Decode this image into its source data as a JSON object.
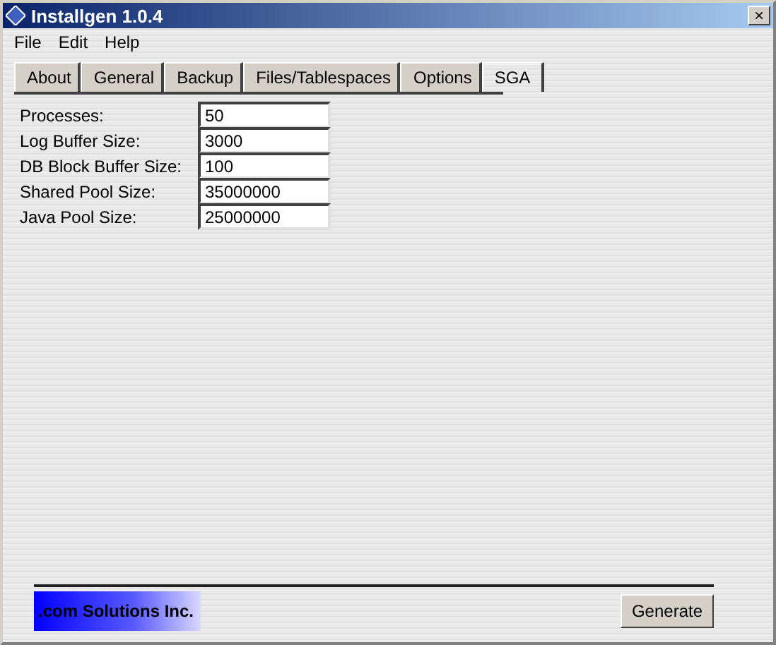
{
  "window": {
    "title": "Installgen 1.0.4",
    "close": "×"
  },
  "menu": [
    "File",
    "Edit",
    "Help"
  ],
  "tabs": [
    {
      "label": "About",
      "selected": false
    },
    {
      "label": "General",
      "selected": false
    },
    {
      "label": "Backup",
      "selected": false
    },
    {
      "label": "Files/Tablespaces",
      "selected": false
    },
    {
      "label": "Options",
      "selected": false
    },
    {
      "label": "SGA",
      "selected": true
    }
  ],
  "fields": [
    {
      "label": "Processes:",
      "value": "50"
    },
    {
      "label": "Log Buffer Size:",
      "value": "3000"
    },
    {
      "label": "DB Block Buffer Size:",
      "value": "100"
    },
    {
      "label": "Shared Pool Size:",
      "value": "35000000"
    },
    {
      "label": "Java Pool Size:",
      "value": "25000000"
    }
  ],
  "footer": {
    "logo": ".com Solutions Inc.",
    "button": "Generate"
  }
}
